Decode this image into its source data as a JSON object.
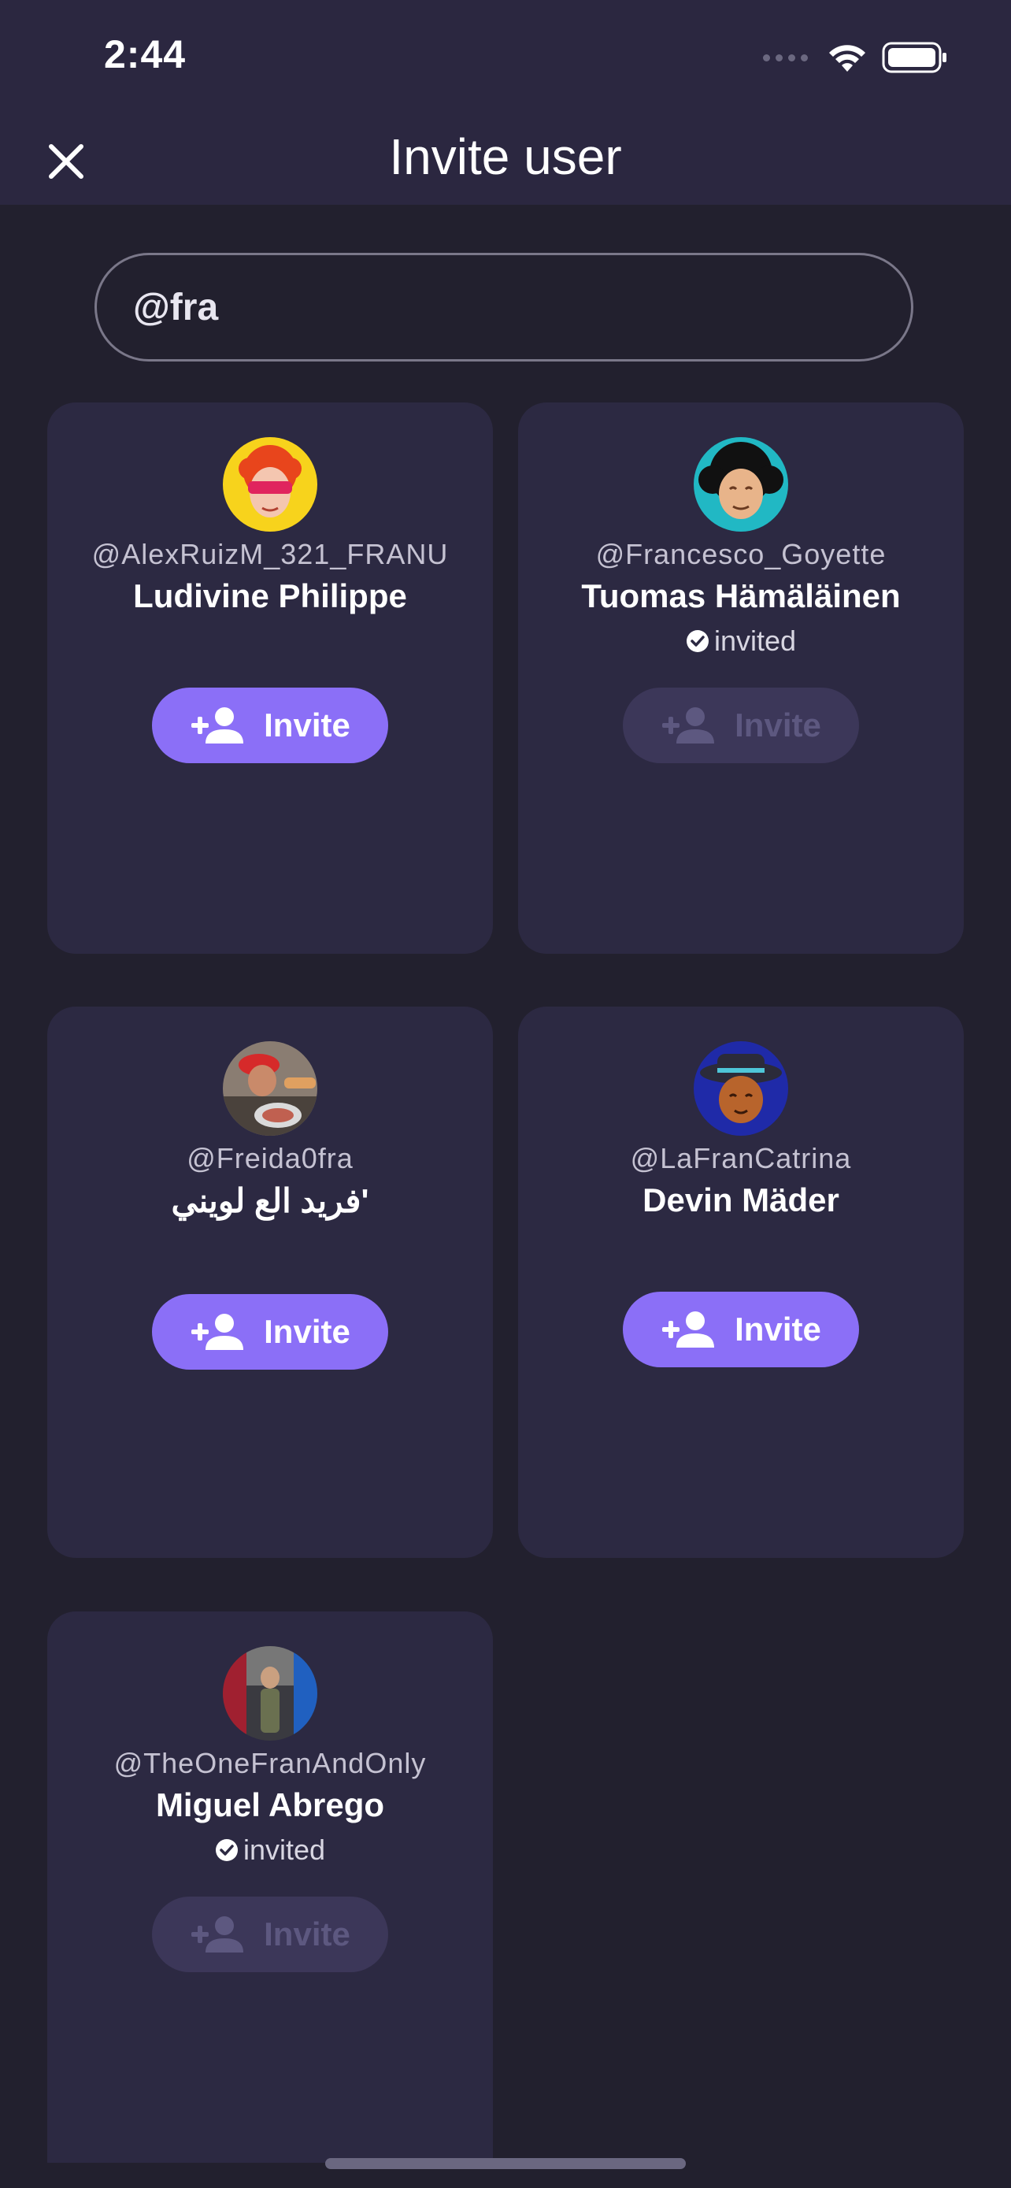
{
  "status_bar": {
    "time": "2:44"
  },
  "header": {
    "title": "Invite user"
  },
  "search": {
    "value": "@fra",
    "placeholder": ""
  },
  "users": [
    {
      "username": "@AlexRuizM_321_FRANU",
      "name": "Ludivine Philippe",
      "invited": false,
      "invite_label": "Invite"
    },
    {
      "username": "@Francesco_Goyette",
      "name": "Tuomas Hämäläinen",
      "invited": true,
      "invited_label": "invited",
      "invite_label": "Invite"
    },
    {
      "username": "@Freida0fra",
      "name": "فريد الع لويني'",
      "invited": false,
      "invite_label": "Invite"
    },
    {
      "username": "@LaFranCatrina",
      "name": "Devin Mäder",
      "invited": false,
      "invite_label": "Invite"
    },
    {
      "username": "@TheOneFranAndOnly",
      "name": "Miguel Abrego",
      "invited": true,
      "invited_label": "invited",
      "invite_label": "Invite"
    }
  ],
  "colors": {
    "accent": "#8b6ff7",
    "card": "#2c2942",
    "background": "#22202e",
    "header": "#2b2740"
  }
}
